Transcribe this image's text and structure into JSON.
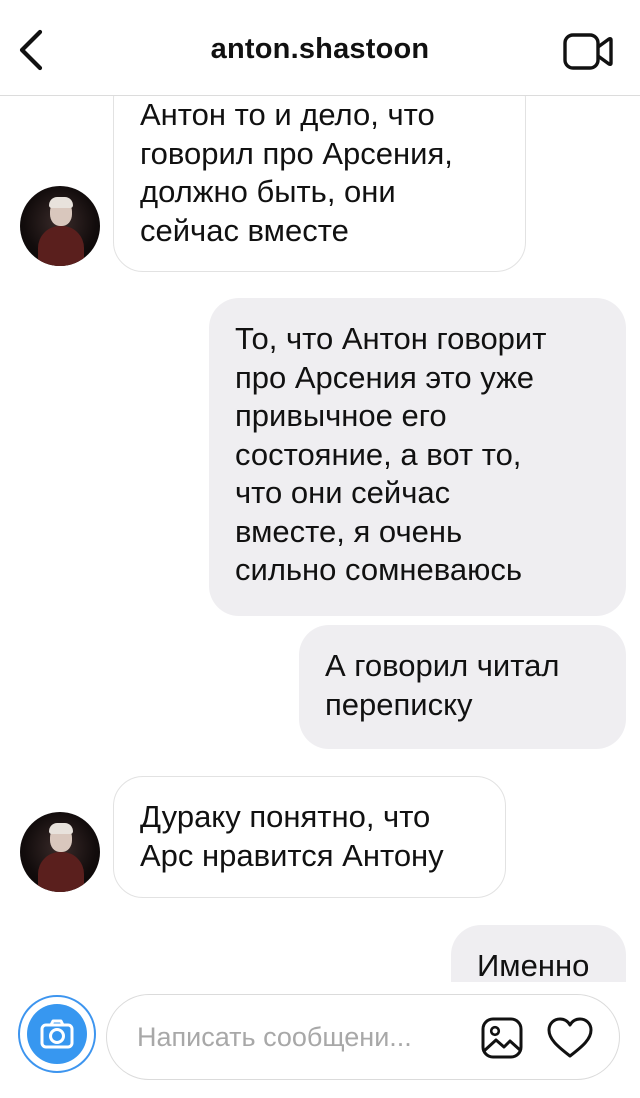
{
  "header": {
    "username": "anton.shastoon",
    "back_icon": "chevron-left-icon",
    "video_icon": "video-camera-icon"
  },
  "messages": [
    {
      "direction": "incoming",
      "text": "Антон то и дело, что\nговорил про Арсения,\nдолжно быть, они\nсейчас вместе"
    },
    {
      "direction": "outgoing",
      "text": "То, что Антон говорит\nпро Арсения это уже\nпривычное его\nсостояние, а вот то,\nчто они сейчас\nвместе, я очень\nсильно сомневаюсь"
    },
    {
      "direction": "outgoing",
      "text": "А говорил читал\nпереписку"
    },
    {
      "direction": "incoming",
      "text": "Дураку понятно, что\nАрс нравится Антону"
    },
    {
      "direction": "outgoing",
      "text": "Именно"
    }
  ],
  "composer": {
    "placeholder": "Написать сообщени...",
    "value": "",
    "camera_icon": "camera-icon",
    "gallery_icon": "image-gallery-icon",
    "like_icon": "heart-icon"
  },
  "colors": {
    "accent": "#3797f0",
    "outgoing_bubble": "#efeef1",
    "incoming_border": "#e2e2e2",
    "placeholder": "#a8a8a8"
  }
}
